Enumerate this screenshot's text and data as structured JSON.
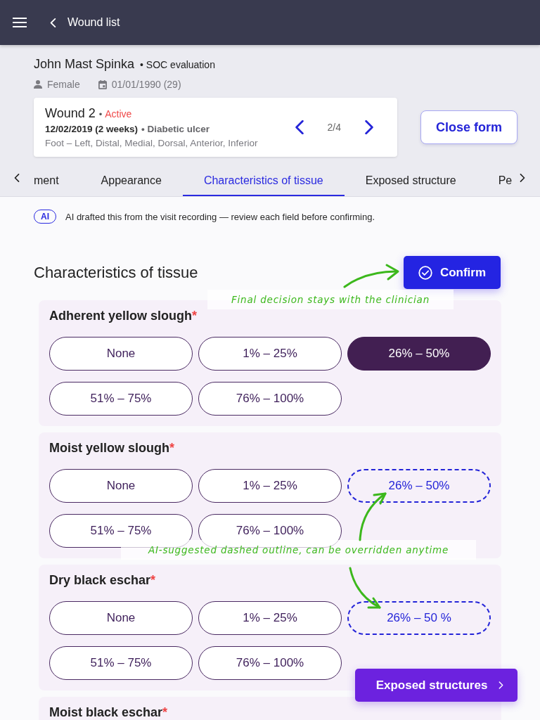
{
  "top_bar": {
    "back_label": "Wound list"
  },
  "patient": {
    "name": "John Mast Spinka",
    "visit_type": "• SOC evaluation",
    "sex": "Female",
    "birth_date": "01/01/1990 (29)"
  },
  "wound": {
    "title": "Wound 2",
    "separator": "•",
    "status": "Active",
    "onset": "12/02/2019 (2 weeks)",
    "type": "• Diabetic ulcer",
    "location": "Foot – Left, Distal, Medial, Dorsal, Anterior, Inferior",
    "position": "2/4"
  },
  "close_button": "Close form",
  "tabs": [
    {
      "label": "ment",
      "selected": false
    },
    {
      "label": "Appearance",
      "selected": false
    },
    {
      "label": "Characteristics of tissue",
      "selected": true
    },
    {
      "label": "Exposed structure",
      "selected": false
    },
    {
      "label": "Pe",
      "selected": false
    }
  ],
  "ai_notice": {
    "badge": "AI",
    "text": "AI drafted this from the visit recording — review each field before confirming."
  },
  "section": {
    "title": "Characteristics of tissue",
    "confirm_button": "Confirm"
  },
  "fields": [
    {
      "label": "Adherent yellow slough",
      "required_mark": "*",
      "options": [
        {
          "label": "None",
          "selected": false,
          "ai_suggested": false
        },
        {
          "label": "1% – 25%",
          "selected": false,
          "ai_suggested": false
        },
        {
          "label": "26% – 50%",
          "selected": true,
          "ai_suggested": false
        },
        {
          "label": "51% – 75%",
          "selected": false,
          "ai_suggested": false
        },
        {
          "label": "76% – 100%",
          "selected": false,
          "ai_suggested": false
        }
      ]
    },
    {
      "label": "Moist yellow slough",
      "required_mark": "*",
      "options": [
        {
          "label": "None",
          "selected": false,
          "ai_suggested": false
        },
        {
          "label": "1% – 25%",
          "selected": false,
          "ai_suggested": false
        },
        {
          "label": "26% – 50%",
          "selected": false,
          "ai_suggested": true
        },
        {
          "label": "51% – 75%",
          "selected": false,
          "ai_suggested": false
        },
        {
          "label": "76% – 100%",
          "selected": false,
          "ai_suggested": false
        }
      ]
    },
    {
      "label": "Dry black eschar",
      "required_mark": "*",
      "options": [
        {
          "label": "None",
          "selected": false,
          "ai_suggested": false
        },
        {
          "label": "1% – 25%",
          "selected": false,
          "ai_suggested": false
        },
        {
          "label": "26% – 50 %",
          "selected": false,
          "ai_suggested": true
        },
        {
          "label": "51% – 75%",
          "selected": false,
          "ai_suggested": false
        },
        {
          "label": "76% – 100%",
          "selected": false,
          "ai_suggested": false
        }
      ]
    },
    {
      "label": "Moist black eschar",
      "required_mark": "*"
    }
  ],
  "next_button": "Exposed structures",
  "annotations": [
    {
      "text": "Final decision stays with the clinician"
    },
    {
      "text": "AI-suggested dashed outline, can be overridden anytime"
    }
  ]
}
